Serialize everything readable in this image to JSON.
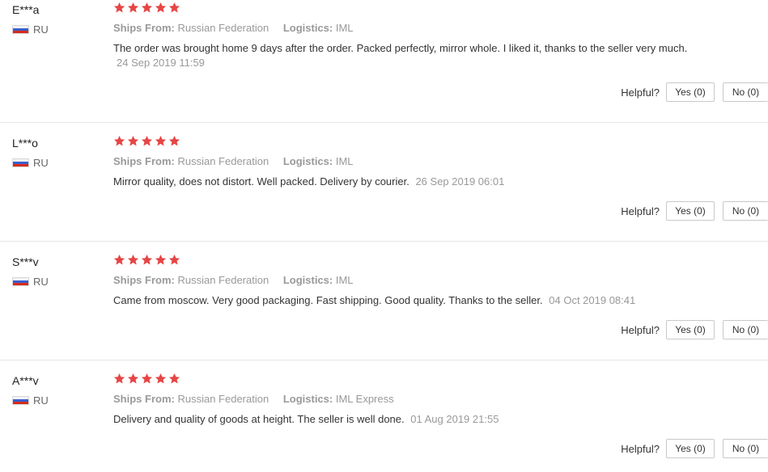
{
  "labels": {
    "ships_from": "Ships From:",
    "logistics": "Logistics:",
    "helpful": "Helpful?"
  },
  "reviews": [
    {
      "user": "E***a",
      "country": "RU",
      "rating": 5,
      "ships_from": "Russian Federation",
      "logistics": "IML",
      "text": "The order was brought home 9 days after the order. Packed perfectly, mirror whole. I liked it, thanks to the seller very much.",
      "date": "24 Sep 2019 11:59",
      "yes_label": "Yes (0)",
      "no_label": "No (0)"
    },
    {
      "user": "L***o",
      "country": "RU",
      "rating": 5,
      "ships_from": "Russian Federation",
      "logistics": "IML",
      "text": "Mirror quality, does not distort. Well packed. Delivery by courier.",
      "date": "26 Sep 2019 06:01",
      "yes_label": "Yes (0)",
      "no_label": "No (0)"
    },
    {
      "user": "S***v",
      "country": "RU",
      "rating": 5,
      "ships_from": "Russian Federation",
      "logistics": "IML",
      "text": "Came from moscow. Very good packaging. Fast shipping. Good quality. Thanks to the seller.",
      "date": "04 Oct 2019 08:41",
      "yes_label": "Yes (0)",
      "no_label": "No (0)"
    },
    {
      "user": "A***v",
      "country": "RU",
      "rating": 5,
      "ships_from": "Russian Federation",
      "logistics": "IML Express",
      "text": "Delivery and quality of goods at height. The seller is well done.",
      "date": "01 Aug 2019 21:55",
      "yes_label": "Yes (0)",
      "no_label": "No (0)"
    }
  ]
}
